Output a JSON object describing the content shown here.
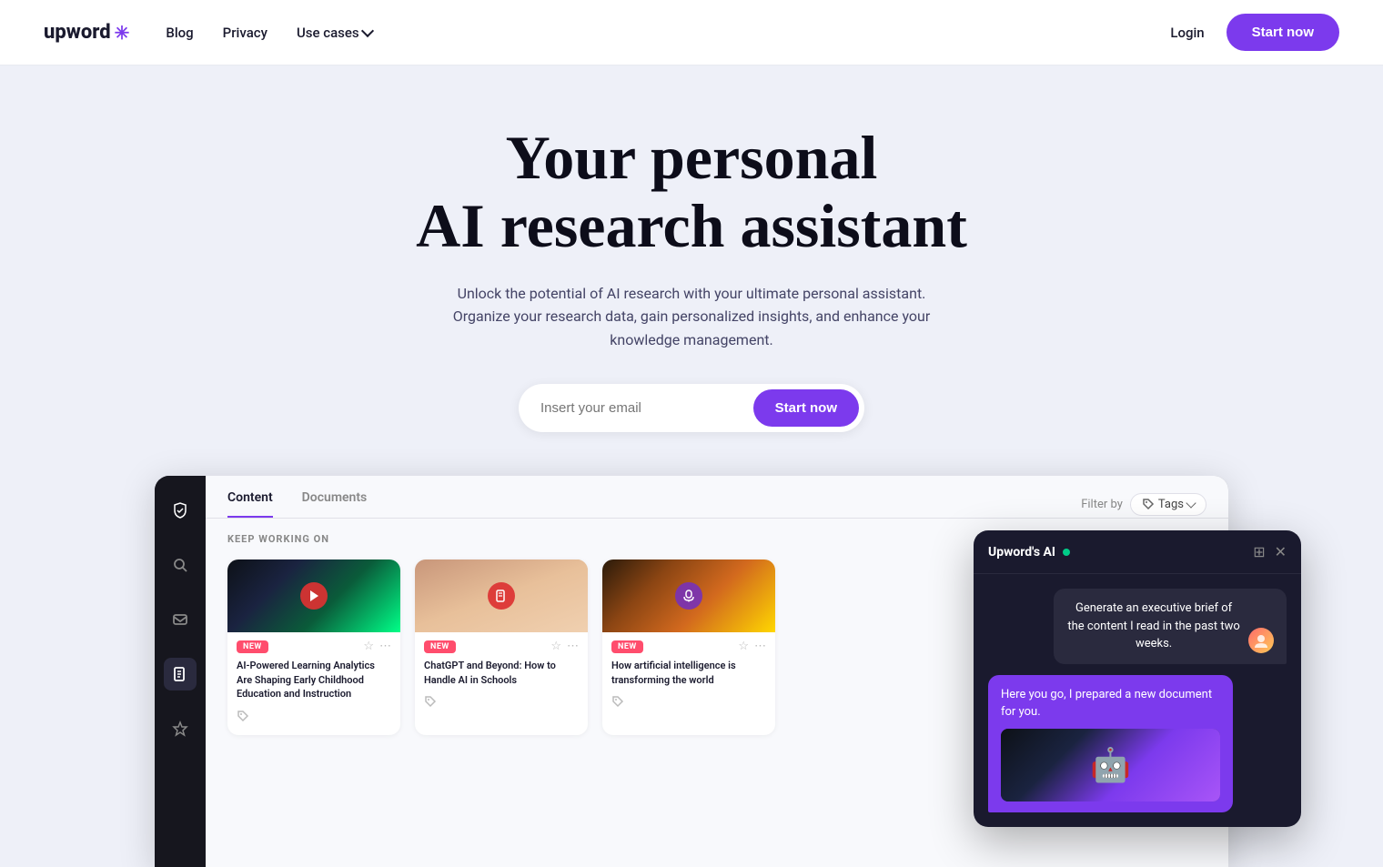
{
  "nav": {
    "logo_text": "upword",
    "logo_asterisk": "✳",
    "links": [
      {
        "label": "Blog",
        "name": "blog-link"
      },
      {
        "label": "Privacy",
        "name": "privacy-link"
      },
      {
        "label": "Use cases",
        "name": "use-cases-link",
        "has_dropdown": true
      }
    ],
    "login_label": "Login",
    "start_now_label": "Start now"
  },
  "hero": {
    "title_line1": "Your personal",
    "title_line2": "AI research assistant",
    "subtitle": "Unlock the potential of AI research with your ultimate personal assistant. Organize your research data, gain personalized insights, and enhance your knowledge management.",
    "email_placeholder": "Insert your email",
    "cta_label": "Start now"
  },
  "dashboard": {
    "tab_content": "Content",
    "tab_documents": "Documents",
    "filter_label": "Filter by",
    "filter_tags_label": "Tags",
    "section_label": "KEEP WORKING ON",
    "cards": [
      {
        "badge": "NEW",
        "title": "AI-Powered Learning Analytics Are Shaping Early Childhood Education and Instruction",
        "thumb_type": "video"
      },
      {
        "badge": "NEW",
        "title": "ChatGPT and Beyond: How to Handle AI in Schools",
        "thumb_type": "pdf"
      },
      {
        "badge": "NEW",
        "title": "How artificial intelligence is transforming the world",
        "thumb_type": "audio"
      }
    ]
  },
  "ai_chat": {
    "title": "Upword's AI",
    "user_message": "Generate an executive brief of the content I read in the past two weeks.",
    "ai_message": "Here you go, I prepared a new document for you."
  }
}
